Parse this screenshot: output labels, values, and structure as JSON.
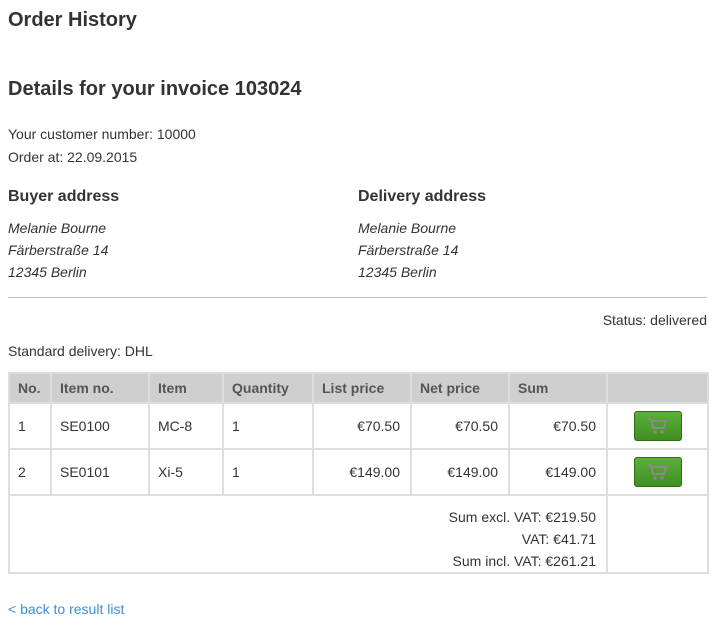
{
  "page": {
    "title": "Order History",
    "invoice_heading": "Details for your invoice 103024",
    "customer_number": "Your customer number: 10000",
    "order_date": "Order at: 22.09.2015"
  },
  "buyer": {
    "heading": "Buyer address",
    "name": "Melanie Bourne",
    "street": "Färberstraße 14",
    "city": "12345 Berlin"
  },
  "delivery": {
    "heading": "Delivery address",
    "name": "Melanie Bourne",
    "street": "Färberstraße 14",
    "city": "12345 Berlin"
  },
  "status": "Status: delivered",
  "shipping": "Standard delivery: DHL",
  "table": {
    "headers": [
      "No.",
      "Item no.",
      "Item",
      "Quantity",
      "List price",
      "Net price",
      "Sum"
    ],
    "rows": [
      {
        "no": "1",
        "item_no": "SE0100",
        "item": "MC-8",
        "quantity": "1",
        "list_price": "€70.50",
        "net_price": "€70.50",
        "sum": "€70.50"
      },
      {
        "no": "2",
        "item_no": "SE0101",
        "item": "Xi-5",
        "quantity": "1",
        "list_price": "€149.00",
        "net_price": "€149.00",
        "sum": "€149.00"
      }
    ],
    "sum_excl_vat": "Sum excl. VAT: €219.50",
    "vat": "VAT: €41.71",
    "sum_incl_vat": "Sum incl. VAT: €261.21"
  },
  "icons": {
    "cart": "shopping-cart-icon"
  },
  "colors": {
    "cart_button": "#4a9e2a",
    "link": "#3a8fd6",
    "header_bg": "#cfcfcf"
  },
  "back_link": "< back to result list"
}
